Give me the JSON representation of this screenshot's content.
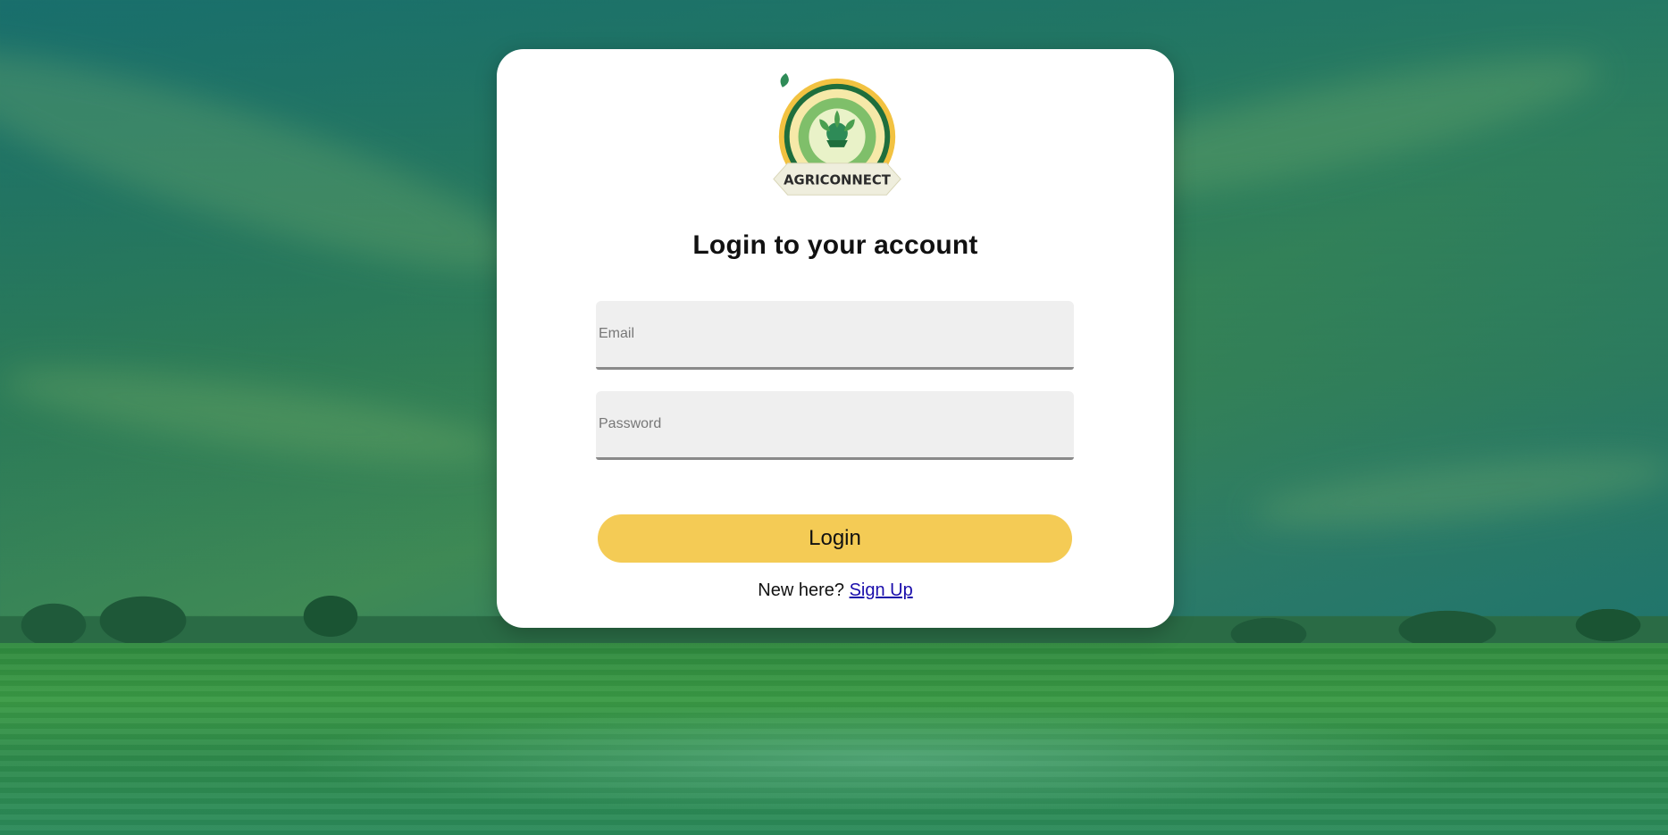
{
  "logo": {
    "brand_text": "AGRICONNECT"
  },
  "login_form": {
    "title": "Login to your account",
    "email_placeholder": "Email",
    "password_placeholder": "Password",
    "login_label": "Login",
    "signup_prompt": "New here?",
    "signup_link": "Sign Up"
  },
  "colors": {
    "accent": "#f4cb55",
    "link": "#1a0dab",
    "card": "#ffffff",
    "logo_green": "#1f6e3c",
    "logo_gold": "#f2c241"
  }
}
